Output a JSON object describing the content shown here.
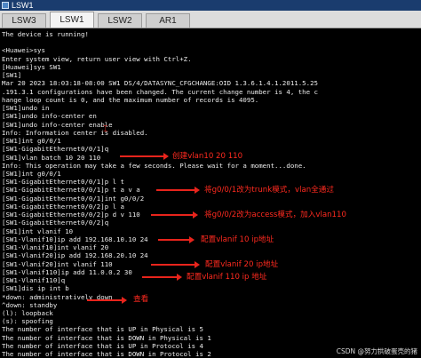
{
  "window": {
    "title": "LSW1"
  },
  "tabs": [
    {
      "label": "LSW3"
    },
    {
      "label": "LSW1"
    },
    {
      "label": "LSW2"
    },
    {
      "label": "AR1"
    }
  ],
  "terminal_lines": [
    "The device is running!",
    "",
    "<Huawei>sys",
    "Enter system view, return user view with Ctrl+Z.",
    "[Huawei]sys SW1",
    "[SW1]",
    "Mar 20 2023 18:03:18-08:00 SW1 DS/4/DATASYNC_CFGCHANGE:OID 1.3.6.1.4.1.2011.5.25",
    ".191.3.1 configurations have been changed. The current change number is 4, the c",
    "hange loop count is 0, and the maximum number of records is 4095.",
    "[SW1]undo in",
    "[SW1]undo info-center en",
    "[SW1]undo info-center enable",
    "Info: Information center is disabled.",
    "[SW1]int g0/0/1",
    "[SW1-GigabitEthernet0/0/1]q",
    "[SW1]vlan batch 10 20 110",
    "Info: This operation may take a few seconds. Please wait for a moment...done.",
    "[SW1]int g0/0/1",
    "[SW1-GigabitEthernet0/0/1]p l t",
    "[SW1-GigabitEthernet0/0/1]p t a v a",
    "[SW1-GigabitEthernet0/0/1]int g0/0/2",
    "[SW1-GigabitEthernet0/0/2]p l a",
    "[SW1-GigabitEthernet0/0/2]p d v 110",
    "[SW1-GigabitEthernet0/0/2]q",
    "[SW1]int vlanif 10",
    "[SW1-Vlanif10]ip add 192.168.10.10 24",
    "[SW1-Vlanif10]int vlanif 20",
    "[SW1-Vlanif20]ip add 192.168.20.10 24",
    "[SW1-Vlanif20]int vlanif 110",
    "[SW1-Vlanif110]ip add 11.0.0.2 30",
    "[SW1-Vlanif110]q",
    "[SW1]dis ip int b",
    "*down: administratively down",
    "^down: standby",
    "(l): loopback",
    "(s): spoofing",
    "The number of interface that is UP in Physical is 5",
    "The number of interface that is DOWN in Physical is 1",
    "The number of interface that is UP in Protocol is 4",
    "The number of interface that is DOWN in Protocol is 2"
  ],
  "annotations": {
    "vlan_create": "创建vlan10 20 110",
    "trunk": "将g0/0/1改为trunk模式，vlan全通过",
    "access": "将g0/0/2改为access模式，加入vlan110",
    "vlanif10": "配置vlanif 10 ip地址",
    "vlanif20": "配置vlanif 20 ip地址",
    "vlanif110": "配置vlanif 110 ip 地址",
    "view": "查看"
  },
  "watermark": "CSDN @努力拱破蛋壳的猪",
  "colors": {
    "terminal_bg": "#000000",
    "terminal_text": "#ececec",
    "annotation": "#ff2a1f",
    "titlebar": "#1a3c6e",
    "tabbar": "#dcdcdc"
  }
}
